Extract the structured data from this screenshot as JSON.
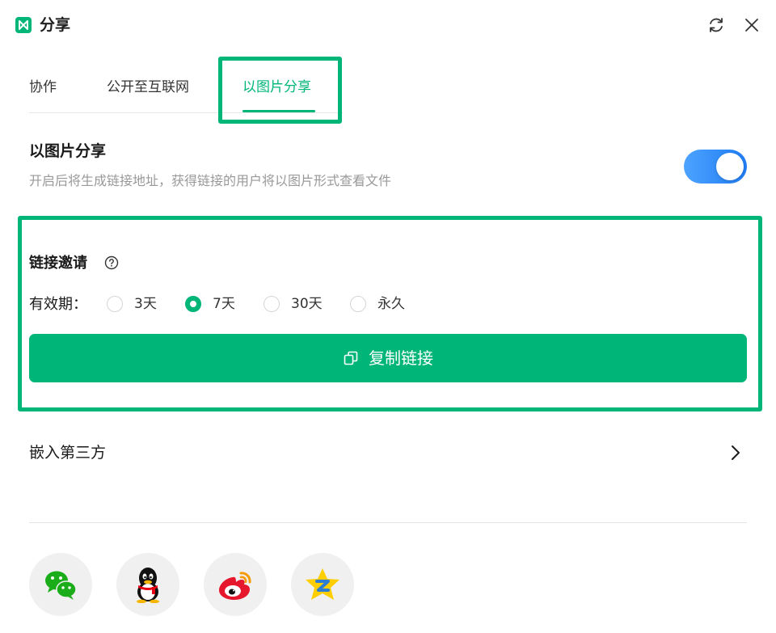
{
  "window": {
    "title": "分享",
    "icons": [
      "app-logo-icon",
      "refresh-icon",
      "close-icon"
    ]
  },
  "tabs": [
    {
      "label": "协作",
      "active": false
    },
    {
      "label": "公开至互联网",
      "active": false
    },
    {
      "label": "以图片分享",
      "active": true
    }
  ],
  "image_share": {
    "title": "以图片分享",
    "description": "开启后将生成链接地址，获得链接的用户将以图片形式查看文件",
    "enabled": true
  },
  "link_invite": {
    "title": "链接邀请",
    "help_icon": "question-circle-icon",
    "validity_label": "有效期：",
    "options": [
      {
        "label": "3天",
        "selected": false
      },
      {
        "label": "7天",
        "selected": true
      },
      {
        "label": "30天",
        "selected": false
      },
      {
        "label": "永久",
        "selected": false
      }
    ],
    "copy_button": {
      "label": "复制链接",
      "icon": "copy-icon"
    }
  },
  "embed": {
    "label": "嵌入第三方",
    "icon": "chevron-right-icon"
  },
  "share_targets": [
    {
      "icon": "wechat-icon"
    },
    {
      "icon": "qq-icon"
    },
    {
      "icon": "weibo-icon"
    },
    {
      "icon": "qzone-icon"
    }
  ],
  "colors": {
    "accent": "#00b578",
    "toggle": "#1f7cf3",
    "highlight_box": "#00b578"
  }
}
